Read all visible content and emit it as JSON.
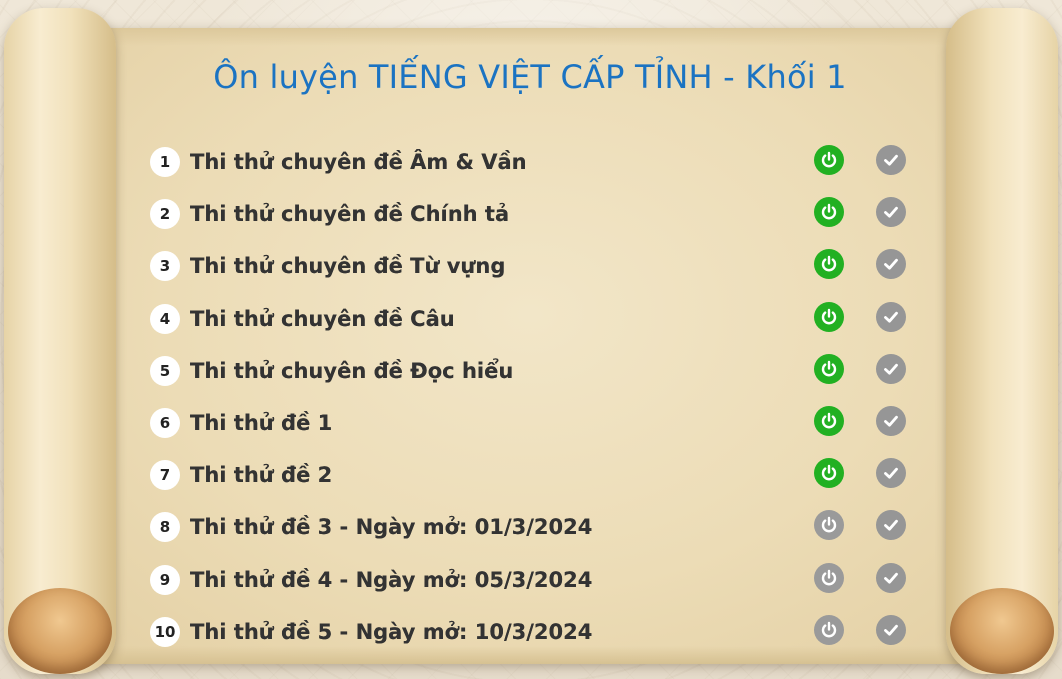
{
  "title": "Ôn luyện TIẾNG VIỆT CẤP TỈNH - Khối 1",
  "colors": {
    "title": "#1b73c2",
    "power_active": "#22b022",
    "power_inactive": "#9a9a9a",
    "check": "#969696"
  },
  "items": [
    {
      "num": "1",
      "label": "Thi thử chuyên đề Âm & Vần",
      "status": "active",
      "power_icon": "power-icon",
      "check_icon": "check-icon"
    },
    {
      "num": "2",
      "label": "Thi thử chuyên đề Chính tả",
      "status": "active",
      "power_icon": "power-icon",
      "check_icon": "check-icon"
    },
    {
      "num": "3",
      "label": "Thi thử chuyên đề Từ vựng",
      "status": "active",
      "power_icon": "power-icon",
      "check_icon": "check-icon"
    },
    {
      "num": "4",
      "label": "Thi thử chuyên đề Câu",
      "status": "active",
      "power_icon": "power-icon",
      "check_icon": "check-icon"
    },
    {
      "num": "5",
      "label": "Thi thử chuyên đề Đọc hiểu",
      "status": "active",
      "power_icon": "power-icon",
      "check_icon": "check-icon"
    },
    {
      "num": "6",
      "label": "Thi thử đề 1",
      "status": "active",
      "power_icon": "power-icon",
      "check_icon": "check-icon"
    },
    {
      "num": "7",
      "label": "Thi thử đề 2",
      "status": "active",
      "power_icon": "power-icon",
      "check_icon": "check-icon"
    },
    {
      "num": "8",
      "label": "Thi thử đề 3 - Ngày mở: 01/3/2024",
      "status": "locked",
      "power_icon": "power-icon",
      "check_icon": "check-icon"
    },
    {
      "num": "9",
      "label": "Thi thử đề 4 - Ngày mở: 05/3/2024",
      "status": "locked",
      "power_icon": "power-icon",
      "check_icon": "check-icon"
    },
    {
      "num": "10",
      "label": "Thi thử đề 5 - Ngày mở: 10/3/2024",
      "status": "locked",
      "power_icon": "power-icon",
      "check_icon": "check-icon"
    }
  ]
}
